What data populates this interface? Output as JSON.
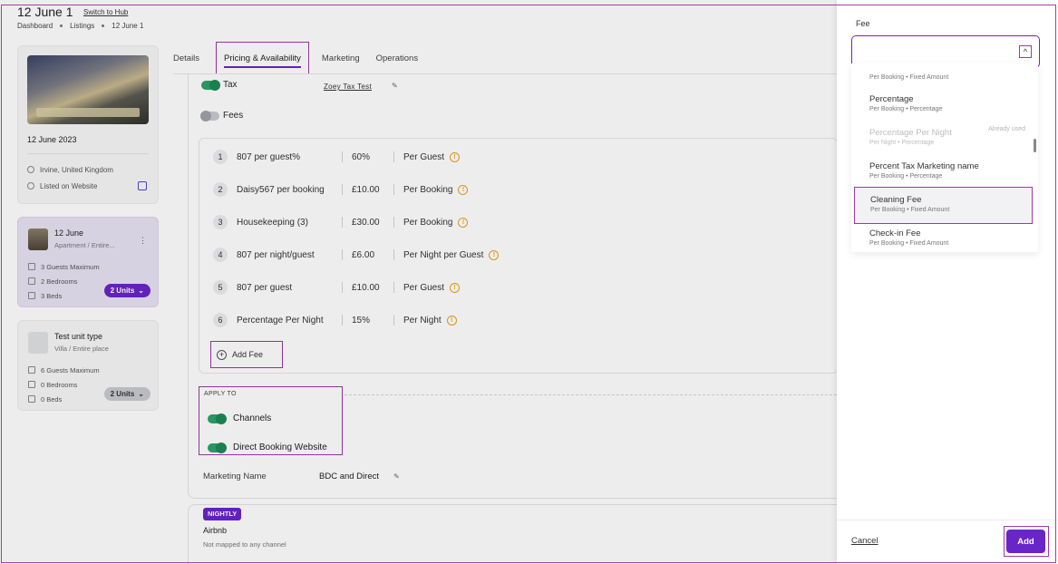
{
  "header": {
    "title": "12 June 1",
    "switch_link": "Switch to Hub",
    "breadcrumb": [
      "Dashboard",
      "Listings",
      "12 June 1"
    ]
  },
  "property": {
    "date": "12 June 2023",
    "location": "Irvine, United Kingdom",
    "listed": "Listed on Website"
  },
  "units": [
    {
      "name": "12 June",
      "type": "Apartment / Entire...",
      "guests": "3 Guests Maximum",
      "bedrooms": "2 Bedrooms",
      "beds": "3 Beds",
      "units_label": "2 Units"
    },
    {
      "name": "Test unit type",
      "type": "Villa / Entire place",
      "guests": "6 Guests Maximum",
      "bedrooms": "0 Bedrooms",
      "beds": "0 Beds",
      "units_label": "2 Units"
    }
  ],
  "tabs": [
    "Details",
    "Pricing & Availability",
    "Marketing",
    "Operations"
  ],
  "tax": {
    "label": "Tax",
    "link": "Zoey Tax Test"
  },
  "fees": {
    "label": "Fees",
    "rows": [
      {
        "num": "1",
        "name": "807 per guest%",
        "amount": "60%",
        "unit": "Per Guest"
      },
      {
        "num": "2",
        "name": "Daisy567 per booking",
        "amount": "£10.00",
        "unit": "Per Booking"
      },
      {
        "num": "3",
        "name": "Housekeeping (3)",
        "amount": "£30.00",
        "unit": "Per Booking"
      },
      {
        "num": "4",
        "name": "807 per night/guest",
        "amount": "£6.00",
        "unit": "Per Night per Guest"
      },
      {
        "num": "5",
        "name": "807 per guest",
        "amount": "£10.00",
        "unit": "Per Guest"
      },
      {
        "num": "6",
        "name": "Percentage Per Night",
        "amount": "15%",
        "unit": "Per Night"
      }
    ],
    "add_label": "Add Fee"
  },
  "apply_to": {
    "label": "APPLY TO",
    "channels": "Channels",
    "direct": "Direct Booking Website"
  },
  "marketing": {
    "label": "Marketing Name",
    "value": "BDC and Direct"
  },
  "rate": {
    "badge": "NIGHTLY",
    "channel": "Airbnb",
    "status": "Not mapped to any channel"
  },
  "drawer": {
    "label": "Fee",
    "options": [
      {
        "name": "Percentage",
        "sub": "Per Booking • Percentage",
        "note": ""
      },
      {
        "name": "Percentage Per Night",
        "sub": "Per Night • Percentage",
        "note": "Already used"
      },
      {
        "name": "Percent Tax Marketing name",
        "sub": "Per Booking • Percentage",
        "note": ""
      },
      {
        "name": "Cleaning Fee",
        "sub": "Per Booking • Fixed Amount",
        "note": ""
      },
      {
        "name": "Check-in Fee",
        "sub": "Per Booking • Fixed Amount",
        "note": ""
      }
    ],
    "partial_sub": "Per Booking • Fixed Amount",
    "cancel": "Cancel",
    "add": "Add"
  }
}
